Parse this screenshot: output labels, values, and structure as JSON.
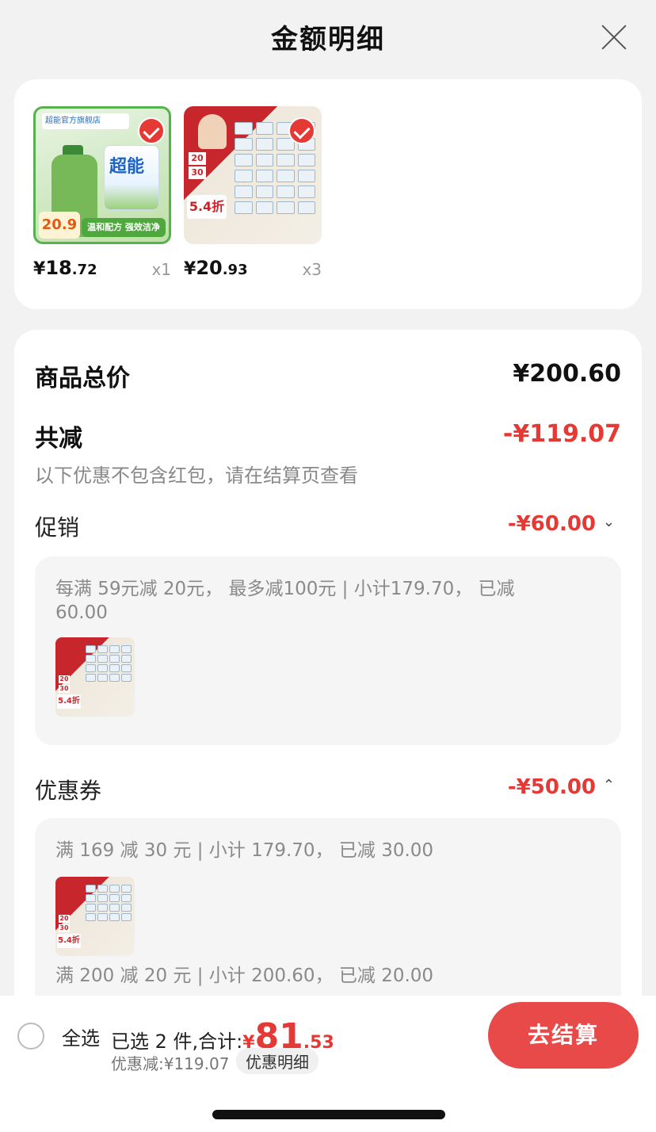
{
  "header": {
    "title": "金额明细"
  },
  "products": [
    {
      "price_symbol": "¥",
      "price_int": "18",
      "price_dec": ".72",
      "qty": "x1",
      "thumb_text_top": "超能官方旗舰店",
      "thumb_text_bottom": "温和配方 强效洁净",
      "thumb_price": "20.9"
    },
    {
      "price_symbol": "¥",
      "price_int": "20",
      "price_dec": ".93",
      "qty": "x3",
      "thumb_text_discount": "5.4折",
      "thumb_text_a": "20",
      "thumb_text_b": "30"
    }
  ],
  "summary": {
    "total_label": "商品总价",
    "total_value": "¥200.60",
    "reduce_label": "共减",
    "reduce_value": "-¥119.07",
    "note": "以下优惠不包含红包，请在结算页查看"
  },
  "promotion": {
    "label": "促销",
    "value": "-¥60.00",
    "line1": "每满 59元减 20元， 最多减100元 | 小计179.70， 已减",
    "line2": "60.00",
    "thumb_discount": "5.4折",
    "thumb_a": "20",
    "thumb_b": "30"
  },
  "coupon": {
    "label": "优惠券",
    "value": "-¥50.00",
    "entry1": "满 169 减 30 元 | 小计 179.70， 已减 30.00",
    "entry2": "满 200 减 20 元 | 小计 200.60， 已减 20.00",
    "thumb_discount": "5.4折",
    "thumb_a": "20",
    "thumb_b": "30"
  },
  "bottom": {
    "select_all": "全选",
    "selected_text": "已选 2 件,合计:",
    "currency": "¥",
    "total_int": "81",
    "total_dec": ".53",
    "discount_text": "优惠减:¥119.07",
    "detail_link": "优惠明细",
    "checkout": "去结算"
  },
  "colors": {
    "accent": "#e53935",
    "button": "#e84a4a"
  }
}
